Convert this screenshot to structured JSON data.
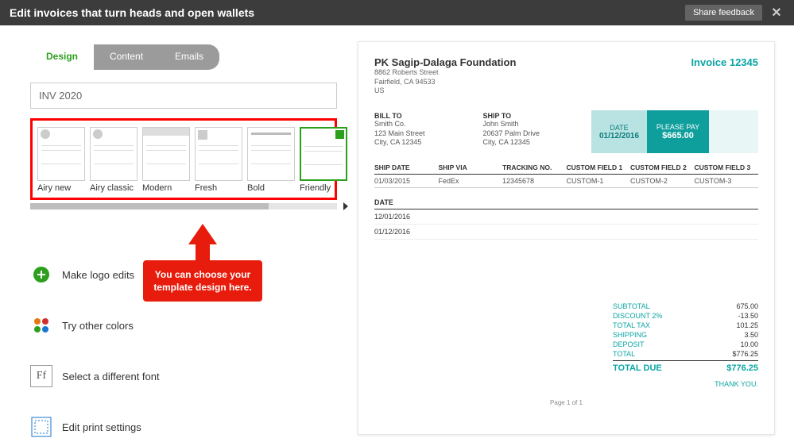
{
  "titlebar": {
    "title": "Edit invoices that turn heads and open wallets",
    "share_label": "Share feedback"
  },
  "tabs": {
    "design": "Design",
    "content": "Content",
    "emails": "Emails"
  },
  "name_field": {
    "value": "INV 2020"
  },
  "templates": [
    {
      "name": "Airy new"
    },
    {
      "name": "Airy classic"
    },
    {
      "name": "Modern"
    },
    {
      "name": "Fresh"
    },
    {
      "name": "Bold"
    },
    {
      "name": "Friendly"
    }
  ],
  "callout": {
    "text": "You can choose your template design here."
  },
  "options": {
    "logo": "Make logo edits",
    "colors": "Try other colors",
    "font": "Select a different font",
    "print": "Edit print settings"
  },
  "preview": {
    "company": "PK Sagip-Dalaga Foundation",
    "address": [
      "8862 Roberts Street",
      "Fairfield, CA 94533",
      "US"
    ],
    "invoice_no": "Invoice 12345",
    "bill_to": {
      "label": "BILL TO",
      "name": "Smith Co.",
      "line1": "123 Main Street",
      "line2": "City, CA 12345"
    },
    "ship_to": {
      "label": "SHIP TO",
      "name": "John Smith",
      "line1": "20637 Palm Drive",
      "line2": "City, CA 12345"
    },
    "date_box": {
      "label": "DATE",
      "value": "01/12/2016"
    },
    "pay_box": {
      "label": "PLEASE PAY",
      "value": "$665.00"
    },
    "columns": [
      "SHIP DATE",
      "SHIP VIA",
      "TRACKING NO.",
      "CUSTOM FIELD 1",
      "CUSTOM FIELD 2",
      "CUSTOM FIELD 3"
    ],
    "column_values": [
      "01/03/2015",
      "FedEx",
      "12345678",
      "CUSTOM-1",
      "CUSTOM-2",
      "CUSTOM-3"
    ],
    "date_header": "DATE",
    "date_rows": [
      "12/01/2016",
      "01/12/2016"
    ],
    "totals": {
      "rows": [
        {
          "label": "SUBTOTAL",
          "value": "675.00"
        },
        {
          "label": "DISCOUNT 2%",
          "value": "-13.50"
        },
        {
          "label": "TOTAL TAX",
          "value": "101.25"
        },
        {
          "label": "SHIPPING",
          "value": "3.50"
        },
        {
          "label": "DEPOSIT",
          "value": "10.00"
        },
        {
          "label": "TOTAL",
          "value": "$776.25"
        }
      ],
      "due_label": "TOTAL DUE",
      "due_value": "$776.25"
    },
    "thank_you": "THANK YOU.",
    "page": "Page 1 of 1"
  }
}
